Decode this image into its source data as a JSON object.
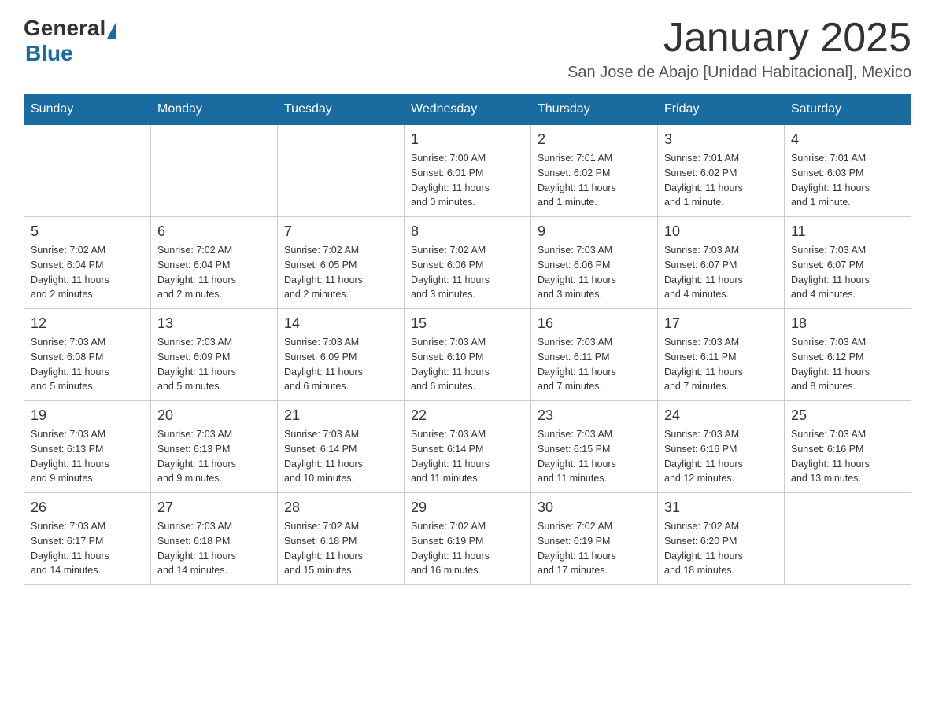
{
  "logo": {
    "general": "General",
    "blue": "Blue"
  },
  "header": {
    "title": "January 2025",
    "subtitle": "San Jose de Abajo [Unidad Habitacional], Mexico"
  },
  "days_of_week": [
    "Sunday",
    "Monday",
    "Tuesday",
    "Wednesday",
    "Thursday",
    "Friday",
    "Saturday"
  ],
  "weeks": [
    [
      {
        "day": "",
        "info": ""
      },
      {
        "day": "",
        "info": ""
      },
      {
        "day": "",
        "info": ""
      },
      {
        "day": "1",
        "info": "Sunrise: 7:00 AM\nSunset: 6:01 PM\nDaylight: 11 hours\nand 0 minutes."
      },
      {
        "day": "2",
        "info": "Sunrise: 7:01 AM\nSunset: 6:02 PM\nDaylight: 11 hours\nand 1 minute."
      },
      {
        "day": "3",
        "info": "Sunrise: 7:01 AM\nSunset: 6:02 PM\nDaylight: 11 hours\nand 1 minute."
      },
      {
        "day": "4",
        "info": "Sunrise: 7:01 AM\nSunset: 6:03 PM\nDaylight: 11 hours\nand 1 minute."
      }
    ],
    [
      {
        "day": "5",
        "info": "Sunrise: 7:02 AM\nSunset: 6:04 PM\nDaylight: 11 hours\nand 2 minutes."
      },
      {
        "day": "6",
        "info": "Sunrise: 7:02 AM\nSunset: 6:04 PM\nDaylight: 11 hours\nand 2 minutes."
      },
      {
        "day": "7",
        "info": "Sunrise: 7:02 AM\nSunset: 6:05 PM\nDaylight: 11 hours\nand 2 minutes."
      },
      {
        "day": "8",
        "info": "Sunrise: 7:02 AM\nSunset: 6:06 PM\nDaylight: 11 hours\nand 3 minutes."
      },
      {
        "day": "9",
        "info": "Sunrise: 7:03 AM\nSunset: 6:06 PM\nDaylight: 11 hours\nand 3 minutes."
      },
      {
        "day": "10",
        "info": "Sunrise: 7:03 AM\nSunset: 6:07 PM\nDaylight: 11 hours\nand 4 minutes."
      },
      {
        "day": "11",
        "info": "Sunrise: 7:03 AM\nSunset: 6:07 PM\nDaylight: 11 hours\nand 4 minutes."
      }
    ],
    [
      {
        "day": "12",
        "info": "Sunrise: 7:03 AM\nSunset: 6:08 PM\nDaylight: 11 hours\nand 5 minutes."
      },
      {
        "day": "13",
        "info": "Sunrise: 7:03 AM\nSunset: 6:09 PM\nDaylight: 11 hours\nand 5 minutes."
      },
      {
        "day": "14",
        "info": "Sunrise: 7:03 AM\nSunset: 6:09 PM\nDaylight: 11 hours\nand 6 minutes."
      },
      {
        "day": "15",
        "info": "Sunrise: 7:03 AM\nSunset: 6:10 PM\nDaylight: 11 hours\nand 6 minutes."
      },
      {
        "day": "16",
        "info": "Sunrise: 7:03 AM\nSunset: 6:11 PM\nDaylight: 11 hours\nand 7 minutes."
      },
      {
        "day": "17",
        "info": "Sunrise: 7:03 AM\nSunset: 6:11 PM\nDaylight: 11 hours\nand 7 minutes."
      },
      {
        "day": "18",
        "info": "Sunrise: 7:03 AM\nSunset: 6:12 PM\nDaylight: 11 hours\nand 8 minutes."
      }
    ],
    [
      {
        "day": "19",
        "info": "Sunrise: 7:03 AM\nSunset: 6:13 PM\nDaylight: 11 hours\nand 9 minutes."
      },
      {
        "day": "20",
        "info": "Sunrise: 7:03 AM\nSunset: 6:13 PM\nDaylight: 11 hours\nand 9 minutes."
      },
      {
        "day": "21",
        "info": "Sunrise: 7:03 AM\nSunset: 6:14 PM\nDaylight: 11 hours\nand 10 minutes."
      },
      {
        "day": "22",
        "info": "Sunrise: 7:03 AM\nSunset: 6:14 PM\nDaylight: 11 hours\nand 11 minutes."
      },
      {
        "day": "23",
        "info": "Sunrise: 7:03 AM\nSunset: 6:15 PM\nDaylight: 11 hours\nand 11 minutes."
      },
      {
        "day": "24",
        "info": "Sunrise: 7:03 AM\nSunset: 6:16 PM\nDaylight: 11 hours\nand 12 minutes."
      },
      {
        "day": "25",
        "info": "Sunrise: 7:03 AM\nSunset: 6:16 PM\nDaylight: 11 hours\nand 13 minutes."
      }
    ],
    [
      {
        "day": "26",
        "info": "Sunrise: 7:03 AM\nSunset: 6:17 PM\nDaylight: 11 hours\nand 14 minutes."
      },
      {
        "day": "27",
        "info": "Sunrise: 7:03 AM\nSunset: 6:18 PM\nDaylight: 11 hours\nand 14 minutes."
      },
      {
        "day": "28",
        "info": "Sunrise: 7:02 AM\nSunset: 6:18 PM\nDaylight: 11 hours\nand 15 minutes."
      },
      {
        "day": "29",
        "info": "Sunrise: 7:02 AM\nSunset: 6:19 PM\nDaylight: 11 hours\nand 16 minutes."
      },
      {
        "day": "30",
        "info": "Sunrise: 7:02 AM\nSunset: 6:19 PM\nDaylight: 11 hours\nand 17 minutes."
      },
      {
        "day": "31",
        "info": "Sunrise: 7:02 AM\nSunset: 6:20 PM\nDaylight: 11 hours\nand 18 minutes."
      },
      {
        "day": "",
        "info": ""
      }
    ]
  ]
}
